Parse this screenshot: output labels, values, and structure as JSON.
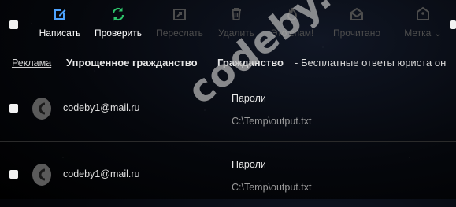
{
  "toolbar": {
    "compose_label": "Написать",
    "check_label": "Проверить",
    "forward_label": "Переслать",
    "delete_label": "Удалить",
    "spam_label": "Это спам!",
    "read_label": "Прочитано",
    "tag_label": "Метка",
    "compose_icon": "compose-icon",
    "check_icon": "refresh-icon",
    "forward_icon": "forward-icon",
    "delete_icon": "trash-icon",
    "spam_icon": "flame-icon",
    "read_icon": "envelope-open-icon",
    "tag_icon": "tag-icon",
    "accent_color": "#4da3ff",
    "check_color": "#2ec46b"
  },
  "ad": {
    "link_label": "Реклама",
    "title": "Упрощенное гражданство",
    "title2": "Гражданство",
    "text": "- Бесплатные ответы юриста он"
  },
  "messages": [
    {
      "from": "codeby1@mail.ru",
      "subject": "Пароли",
      "snippet": "C:\\Temp\\output.txt"
    },
    {
      "from": "codeby1@mail.ru",
      "subject": "Пароли",
      "snippet": "C:\\Temp\\output.txt"
    }
  ],
  "watermark": "codeby.net"
}
